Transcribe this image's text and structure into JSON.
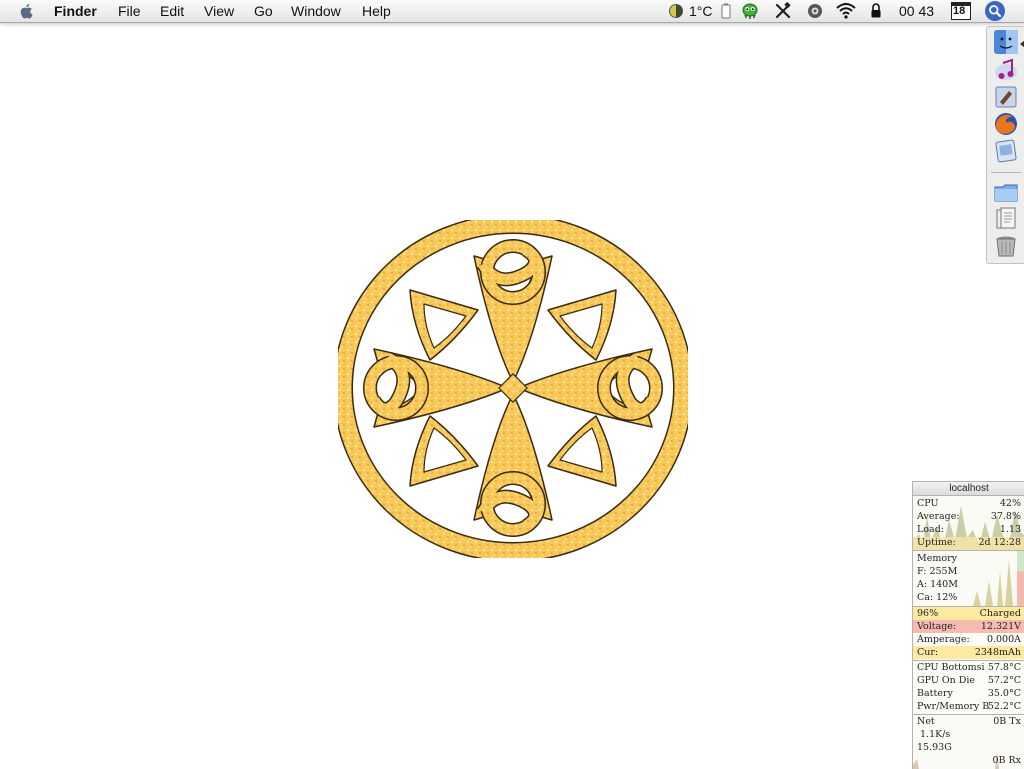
{
  "menubar": {
    "items": [
      "Finder",
      "File",
      "Edit",
      "View",
      "Go",
      "Window",
      "Help"
    ],
    "temperature": "1°C",
    "clock": "00 43",
    "calendar_day": "18"
  },
  "dock": {
    "icons": [
      "finder-icon",
      "itunes-icon",
      "mail-icon",
      "firefox-icon",
      "preview-icon",
      "applications-folder-icon",
      "documents-stack-icon",
      "trash-icon"
    ]
  },
  "monitor": {
    "host": "localhost",
    "cpu": {
      "cpu_label": "CPU",
      "cpu_value": "42%",
      "avg_label": "Average:",
      "avg_value": "37.8%",
      "load_label": "Load:",
      "load_value": "1.13",
      "uptime_label": "Uptime:",
      "uptime_value": "2d 12:28"
    },
    "memory": {
      "title": "Memory",
      "f": "F: 255M",
      "a": "A: 140M",
      "ca": "Ca: 12%"
    },
    "battery": {
      "percent": "96%",
      "state": "Charged",
      "voltage_label": "Voltage:",
      "voltage_value": "12.321V",
      "amperage_label": "Amperage:",
      "amperage_value": "0.000A",
      "cur_label": "Cur:",
      "cur_value": "2348mAh"
    },
    "temps": [
      {
        "label": "CPU Bottomsi",
        "value": "57.8°C"
      },
      {
        "label": "GPU On Die",
        "value": "57.2°C"
      },
      {
        "label": "Battery",
        "value": "35.0°C"
      },
      {
        "label": "Pwr/Memory B",
        "value": "52.2°C"
      }
    ],
    "net": {
      "label": "Net",
      "tx": "0B Tx",
      "rate": "1.1K/s",
      "total": "15.93G",
      "rx": "0B Rx"
    }
  },
  "colors": {
    "gold": "#f6c04a",
    "gold_light": "#fbe08a",
    "outline": "#3a2a10",
    "battery_band": "#fde9a0",
    "voltage_band": "#f7b9b0"
  }
}
